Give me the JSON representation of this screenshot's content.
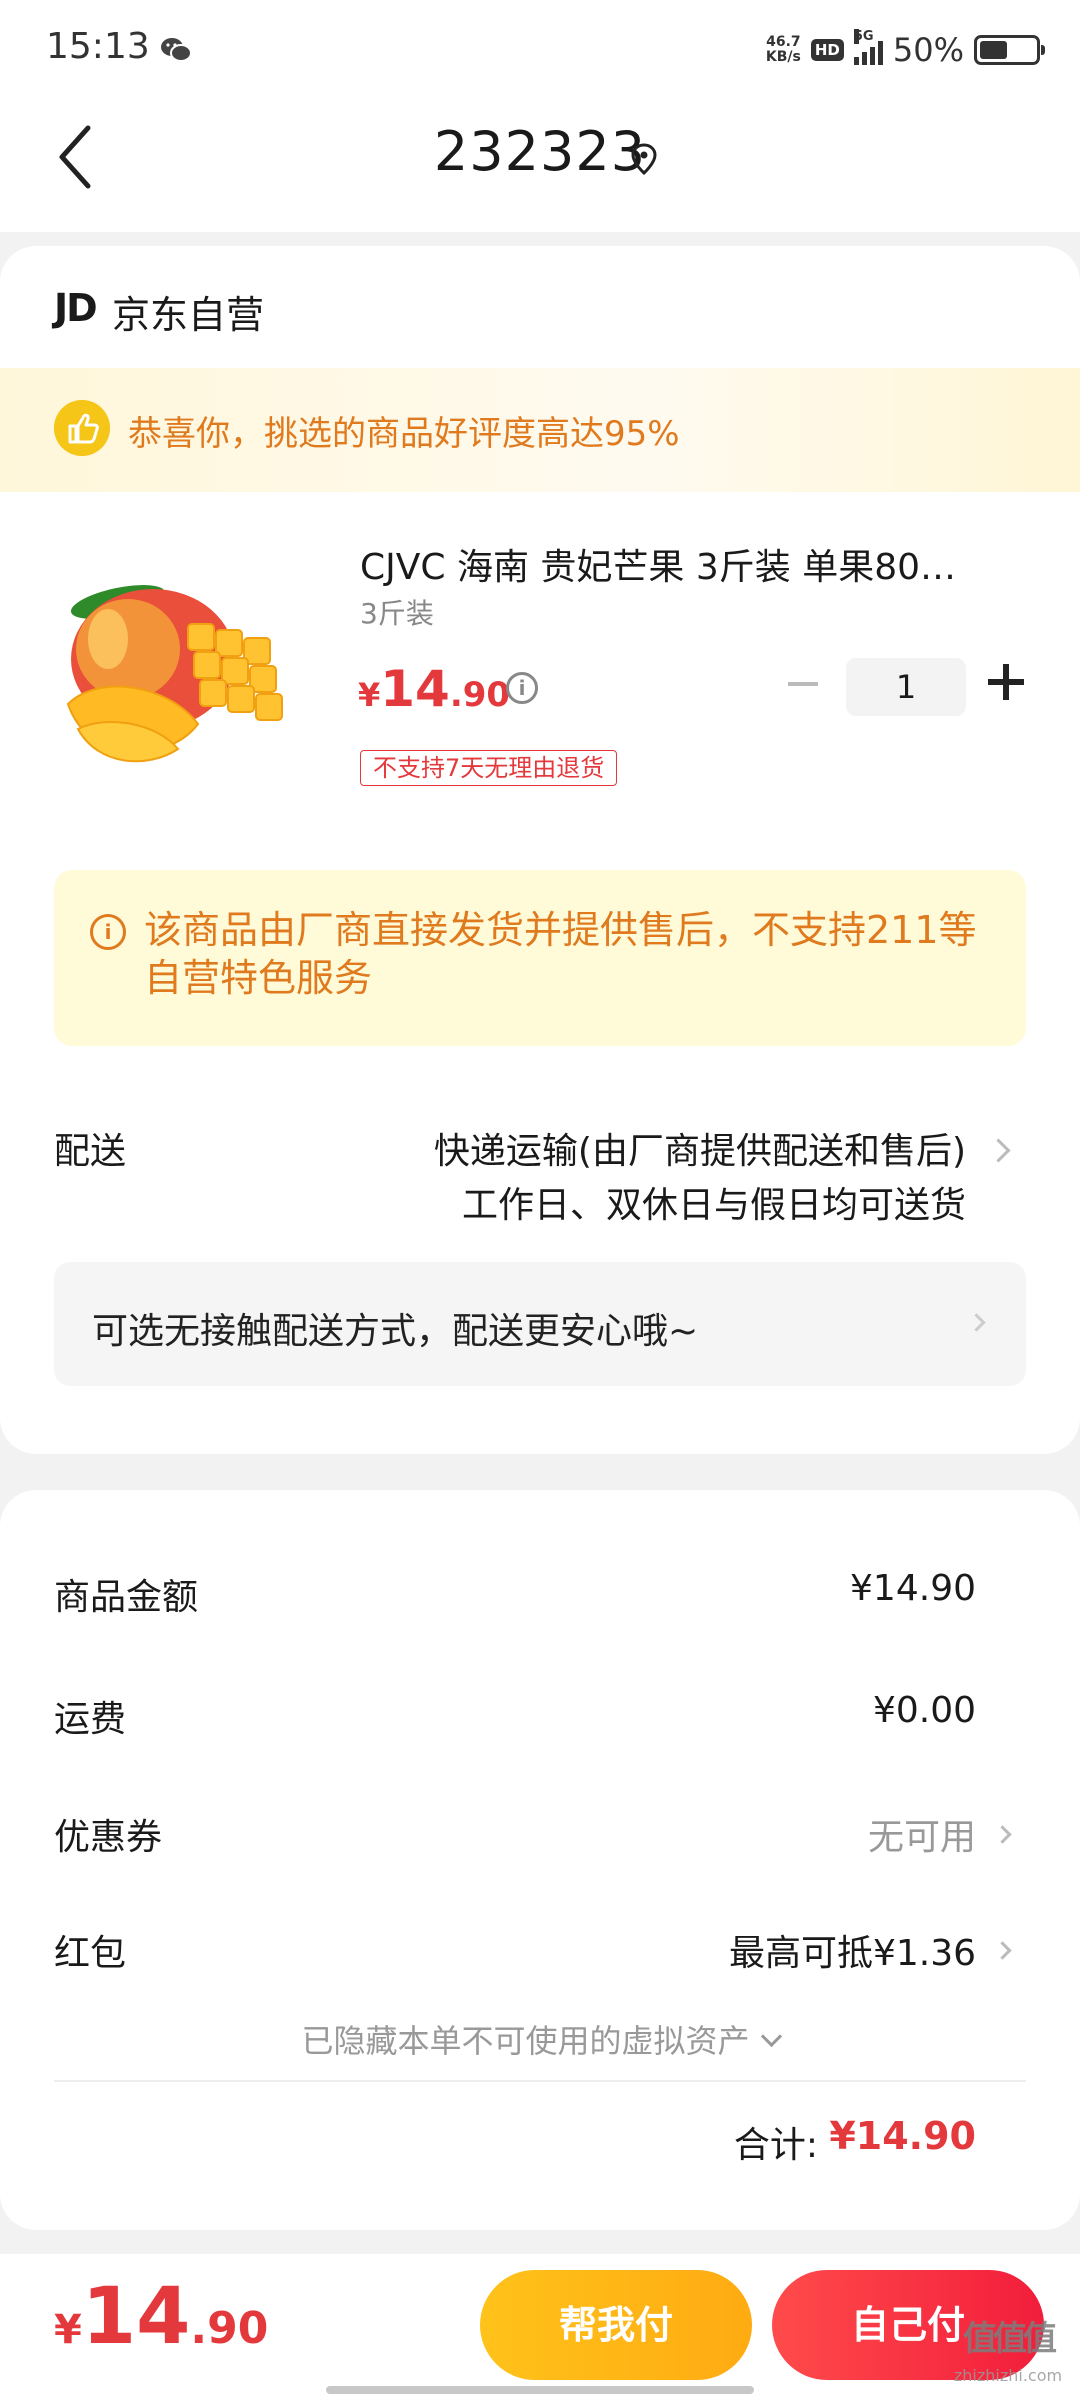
{
  "status_bar": {
    "time": "15:13",
    "net_speed_value": "46.7",
    "net_speed_unit": "KB/s",
    "hd_label": "HD",
    "network_label": "5G",
    "battery_percent": "50%",
    "battery_level": 0.5,
    "icons": [
      "wechat-icon",
      "signal-icon",
      "battery-icon"
    ]
  },
  "header": {
    "title": "232323",
    "icons": [
      "back-arrow-icon",
      "location-pin-icon"
    ]
  },
  "store": {
    "logo_text": "JD",
    "name": "京东自营"
  },
  "praise": {
    "text": "恭喜你，挑选的商品好评度高达95%",
    "icon": "thumbs-up-icon"
  },
  "product": {
    "title": "CJVC 海南 贵妃芒果 3斤装 单果80…",
    "spec": "3斤装",
    "price_currency": "¥",
    "price_int": "14",
    "price_dec": ".90",
    "quantity": "1",
    "return_tag": "不支持7天无理由退货",
    "image_icon": "mango-image"
  },
  "notice": {
    "text": "该商品由厂商直接发货并提供售后，不支持211等自营特色服务"
  },
  "delivery": {
    "label": "配送",
    "method": "快递运输(由厂商提供配送和售后)",
    "schedule": "工作日、双休日与假日均可送货",
    "contactless": "可选无接触配送方式，配送更安心哦~"
  },
  "summary": {
    "goods_label": "商品金额",
    "goods_value": "¥14.90",
    "shipping_label": "运费",
    "shipping_value": "¥0.00",
    "coupon_label": "优惠券",
    "coupon_value": "无可用",
    "redpacket_label": "红包",
    "redpacket_value": "最高可抵¥1.36",
    "hidden_note": "已隐藏本单不可使用的虚拟资产",
    "total_label": "合计:",
    "total_value": "¥14.90"
  },
  "bottom": {
    "price_currency": "¥",
    "price_int": "14",
    "price_dec": ".90",
    "help_pay": "帮我付",
    "self_pay": "自己付"
  },
  "watermark": {
    "glyph": "值值值",
    "site": "zhizhizhi.com"
  },
  "colors": {
    "accent_red": "#e4393c",
    "notice_orange": "#e07a1e",
    "help_pay_yellow": "#ffb915"
  }
}
